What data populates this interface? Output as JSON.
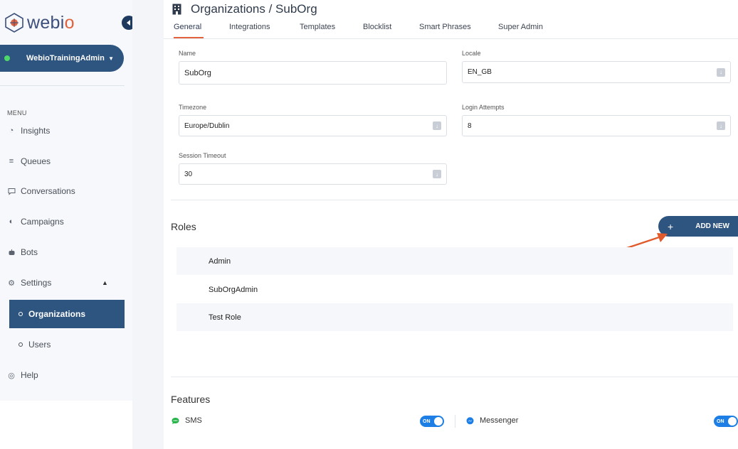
{
  "brand": {
    "logo_text_prefix": "webi",
    "logo_text_suffix": "o",
    "accent": "#e1623c",
    "primary": "#2e5480"
  },
  "account": {
    "name": "WebioTrainingAdmin",
    "status_color": "#4ed86a"
  },
  "sidebar": {
    "menu_label": "MENU",
    "items": [
      {
        "label": "Insights",
        "icon": "insights-icon"
      },
      {
        "label": "Queues",
        "icon": "queues-icon"
      },
      {
        "label": "Conversations",
        "icon": "conversations-icon"
      },
      {
        "label": "Campaigns",
        "icon": "campaigns-icon"
      },
      {
        "label": "Bots",
        "icon": "bots-icon"
      },
      {
        "label": "Settings",
        "icon": "gear-icon"
      }
    ],
    "settings_sub": [
      {
        "label": "Organizations",
        "active": true
      },
      {
        "label": "Users",
        "active": false
      }
    ],
    "help_label": "Help"
  },
  "header": {
    "title": "Organizations / SubOrg"
  },
  "tabs": [
    "General",
    "Integrations",
    "Templates",
    "Blocklist",
    "Smart Phrases",
    "Super Admin"
  ],
  "form": {
    "name": {
      "label": "Name",
      "value": "SubOrg"
    },
    "locale": {
      "label": "Locale",
      "value": "EN_GB"
    },
    "timezone": {
      "label": "Timezone",
      "value": "Europe/Dublin"
    },
    "login_attempts": {
      "label": "Login Attempts",
      "value": "8"
    },
    "session_timeout": {
      "label": "Session Timeout",
      "value": "30"
    }
  },
  "roles": {
    "title": "Roles",
    "add_button": "ADD NEW",
    "add_plus": "+",
    "rows": [
      "Admin",
      "SubOrgAdmin",
      "Test Role",
      ""
    ]
  },
  "features": {
    "title": "Features",
    "items": [
      {
        "label": "SMS",
        "toggle": "ON",
        "icon_color": "#25b34a"
      },
      {
        "label": "Messenger",
        "toggle": "ON",
        "icon_color": "#1d7fe6"
      }
    ]
  }
}
